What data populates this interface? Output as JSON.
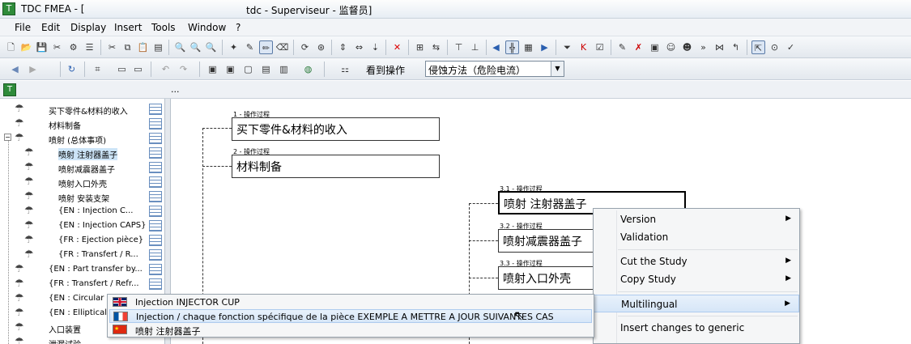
{
  "window": {
    "app_title": "TDC FMEA - [",
    "doc_title": "tdc - Superviseur - 监督员]"
  },
  "menu": [
    "File",
    "Edit",
    "Display",
    "Insert",
    "Tools",
    "Window",
    "?"
  ],
  "toolbar2": {
    "view_op_label": "看到操作",
    "combo_value": "侵蚀方法（危险电流）"
  },
  "tree": [
    {
      "label": "买下零件&材料的收入",
      "selected": false
    },
    {
      "label": "材料制备",
      "selected": false
    },
    {
      "label": "喷射 (总体事项)",
      "selected": false
    },
    {
      "label": "喷射 注射器盖子",
      "selected": true
    },
    {
      "label": "喷射减震器盖子",
      "selected": false
    },
    {
      "label": "喷射入口外壳",
      "selected": false
    },
    {
      "label": "喷射 安装支架",
      "selected": false
    },
    {
      "label": "{EN : Injection C...",
      "selected": false
    },
    {
      "label": "{EN : Injection CAPS}",
      "selected": false
    },
    {
      "label": "{FR : Ejection pièce}",
      "selected": false
    },
    {
      "label": "{FR : Transfert / R...",
      "selected": false
    },
    {
      "label": "{EN : Part transfer by...",
      "selected": false
    },
    {
      "label": "{FR : Transfert / Refr...",
      "selected": false
    },
    {
      "label": "{EN : Circular c",
      "selected": false
    },
    {
      "label": "{EN : Elliptical c",
      "selected": false
    },
    {
      "label": "入口装置",
      "selected": false
    },
    {
      "label": "泄漏试验",
      "selected": false
    }
  ],
  "diagram": [
    {
      "caption": "1 - 操作过程",
      "label": "买下零件&材料的收入"
    },
    {
      "caption": "2 - 操作过程",
      "label": "材料制备"
    },
    {
      "caption": "3.1 - 操作过程",
      "label": "喷射 注射器盖子"
    },
    {
      "caption": "3.2 - 操作过程",
      "label": "喷射减震器盖子"
    },
    {
      "caption": "3.3 - 操作过程",
      "label": "喷射入口外壳"
    }
  ],
  "context_menu": [
    {
      "label": "Version",
      "submenu": true
    },
    {
      "label": "Validation",
      "submenu": false
    },
    {
      "label": "Cut the Study",
      "submenu": true
    },
    {
      "label": "Copy Study",
      "submenu": true
    },
    {
      "label": "Multilingual",
      "submenu": true,
      "highlighted": true
    },
    {
      "label": "Insert changes to generic",
      "submenu": false
    }
  ],
  "language_menu": [
    {
      "flag": "uk-flag-icon",
      "text": "Injection INJECTOR CUP"
    },
    {
      "flag": "fr-flag-icon",
      "text": "Injection / chaque fonction spécifique de la pièce  EXEMPLE A METTRE A JOUR SUIVANTES CAS",
      "highlighted": true
    },
    {
      "flag": "cn-flag-icon",
      "text": "喷射 注射器盖子"
    }
  ]
}
